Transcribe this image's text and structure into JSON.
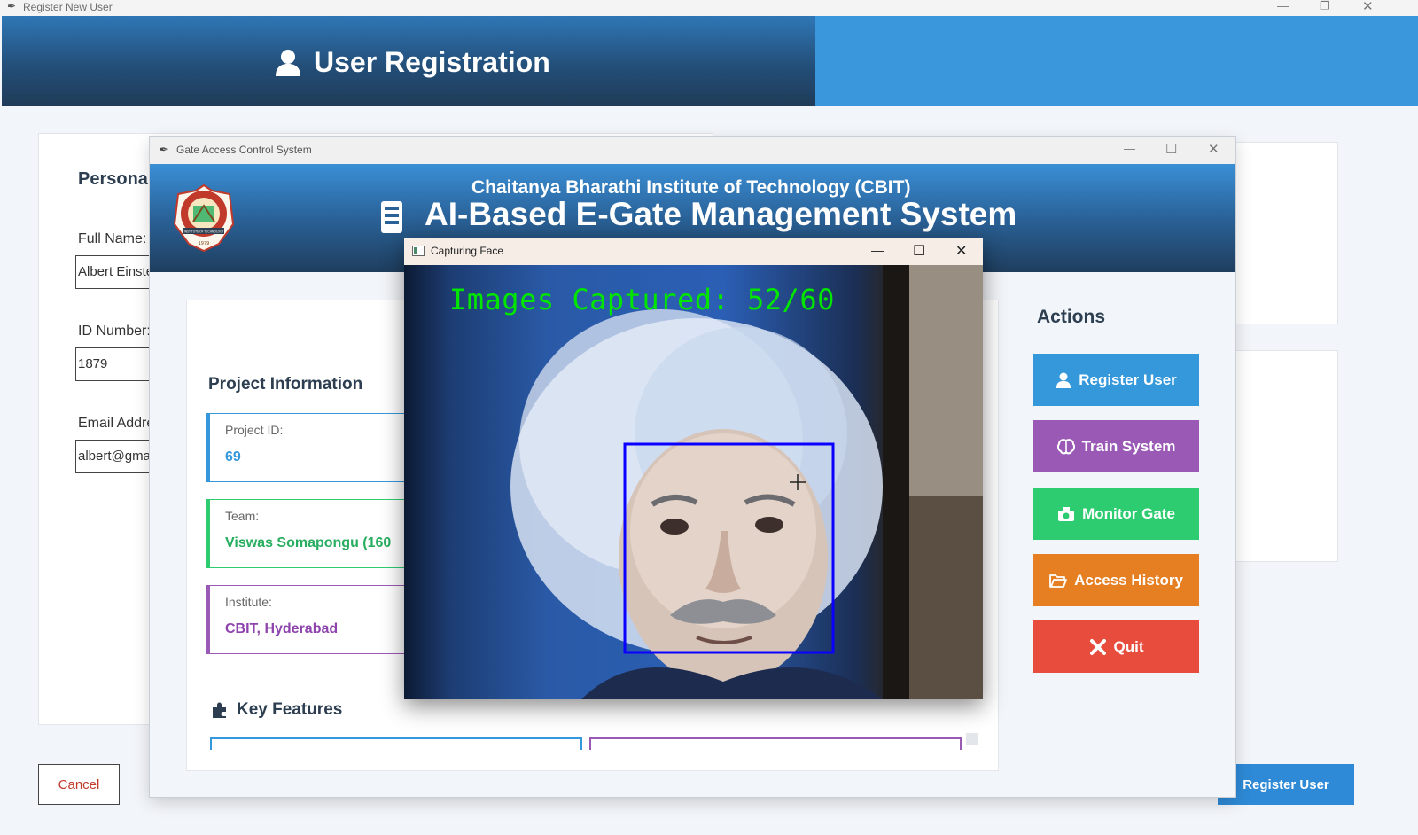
{
  "register_window": {
    "title": "Register New User",
    "header_title": "User Registration",
    "section_title": "Personal Information",
    "fields": [
      {
        "label": "Full Name:",
        "value": "Albert Einstein"
      },
      {
        "label": "ID Number:",
        "value": "1879"
      },
      {
        "label": "Email Address:",
        "value": "albert@gmail.com"
      }
    ],
    "cancel_label": "Cancel",
    "register_label": "Register User"
  },
  "gate_window": {
    "title": "Gate Access Control System",
    "institute": "Chaitanya Bharathi Institute of Technology (CBIT)",
    "system_title": "AI-Based E-Gate Management System",
    "logo_text": "INSTITUTE OF TECHNOLOGY",
    "logo_year": "1979",
    "project_info_title": "Project Information",
    "cards": [
      {
        "key": "Project ID:",
        "value": "69",
        "color": "#3498db"
      },
      {
        "key": "Team:",
        "value": "Viswas Somapongu (160",
        "color": "#2ecc71"
      },
      {
        "key": "Institute:",
        "value": "CBIT, Hyderabad",
        "color": "#9b59b6"
      }
    ],
    "key_features_title": "Key Features",
    "actions_title": "Actions",
    "actions": [
      {
        "label": "Register User",
        "icon": "user-icon",
        "color": "#3498db"
      },
      {
        "label": "Train System",
        "icon": "brain-icon",
        "color": "#9b59b6"
      },
      {
        "label": "Monitor Gate",
        "icon": "camera-icon",
        "color": "#2ecc71"
      },
      {
        "label": "Access History",
        "icon": "folder-icon",
        "color": "#e67e22"
      },
      {
        "label": "Quit",
        "icon": "x-icon",
        "color": "#e74c3c"
      }
    ]
  },
  "capture_window": {
    "title": "Capturing Face",
    "overlay_text": "Images Captured: 52/60",
    "progress": {
      "captured": 52,
      "total": 60
    },
    "overlay_color": "#00e600",
    "face_box_color": "#0a00ff"
  }
}
